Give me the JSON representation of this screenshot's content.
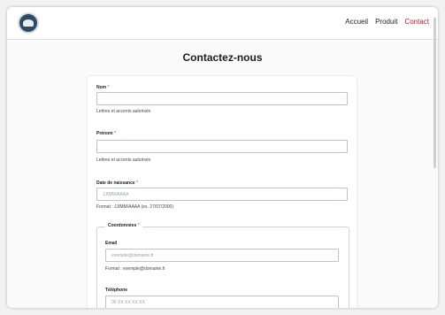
{
  "nav": {
    "links": [
      "Accueil",
      "Produit",
      "Contact"
    ]
  },
  "page": {
    "title": "Contactez-nous"
  },
  "form": {
    "nom": {
      "label": "Nom",
      "required": "*",
      "hint": "Lettres et accents autorisés"
    },
    "prenom": {
      "label": "Prénom",
      "required": "*",
      "hint": "Lettres et accents autorisés"
    },
    "dob": {
      "label": "Date de naissance",
      "required": "*",
      "placeholder": "JJ/MM/AAAA",
      "hint": "Format : JJ/MM/AAAA (ex. 27/07/2000)"
    },
    "coordonnees": {
      "legend": "Coordonnées",
      "required": "*"
    },
    "email": {
      "label": "Email",
      "placeholder": "exemple@domaine.fr",
      "hint": "Format : exemple@domaine.fr"
    },
    "telephone": {
      "label": "Téléphone",
      "placeholder": "06 XX XX XX XX"
    }
  },
  "colors": {
    "accent": "#b01b2e",
    "background": "#fafafa"
  }
}
